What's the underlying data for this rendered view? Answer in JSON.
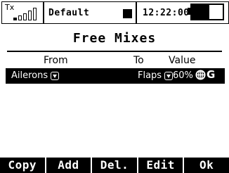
{
  "status_bar": {
    "tx_label": "Tx",
    "model_name": "Default",
    "time": "12:22:00",
    "battery_text": "57%",
    "battery_level_percent": 57
  },
  "page": {
    "title": "Free Mixes"
  },
  "table": {
    "headers": {
      "from": "From",
      "to": "To",
      "value": "Value"
    },
    "rows": [
      {
        "from": "Ailerons",
        "to": "Flaps",
        "value": "60%",
        "scope": "G",
        "selected": true
      }
    ]
  },
  "softkeys": [
    "Copy",
    "Add",
    "Del.",
    "Edit",
    "Ok"
  ],
  "colors": {
    "foreground": "#000000",
    "background": "#ffffff",
    "highlight": "#000000"
  },
  "icons": {
    "tx_signal": "signal-bars-icon",
    "recording": "record-square-icon",
    "battery": "battery-icon",
    "dropdown": "dropdown-arrow-icon",
    "scope": "globe-icon"
  }
}
